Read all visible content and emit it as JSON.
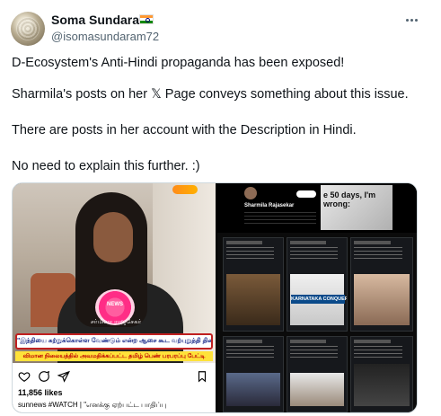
{
  "author": {
    "name": "Soma Sundaram",
    "handle": "@isomasundaram72"
  },
  "icons": {
    "flag": "india-flag-icon",
    "more": "more-options-icon",
    "heart": "heart-icon",
    "comment": "comment-icon",
    "share": "share-icon",
    "bookmark": "bookmark-icon"
  },
  "tweet": {
    "line1": "D-Ecosystem's Anti-Hindi propaganda has been exposed!",
    "line2": "Sharmila's posts on her 𝕏 Page conveys something about this issue.",
    "line3": "There are posts in her account with the Description in Hindi.",
    "line4": "No need to explain this further. :)"
  },
  "media_left": {
    "mic_label": "NEWS",
    "name_tag": "சர்மிளா ராஜசேகர்",
    "banner_main": "\"இந்தியை கற்றுக்கொள்ள வேண்டும் என்ற ஆசை கூட வற்புறுத்தி திணிப்பதால் போய் விட்டது\"",
    "banner_sub": "விமான நிலையத்தில் அவமதிக்கப்பட்ட தமிழ் பெண் பரபரப்பு பேட்டி",
    "likes": "11,856 likes",
    "caption": "sunnews #WATCH | \"எனக்கு ஏற்பட்ட பாதிப்பு"
  },
  "media_right": {
    "profile_name": "Sharmila Rajasekar",
    "news_text": "e 50 days, I'm wrong:",
    "karnataka": "KARNATAKA CONQUERED"
  }
}
